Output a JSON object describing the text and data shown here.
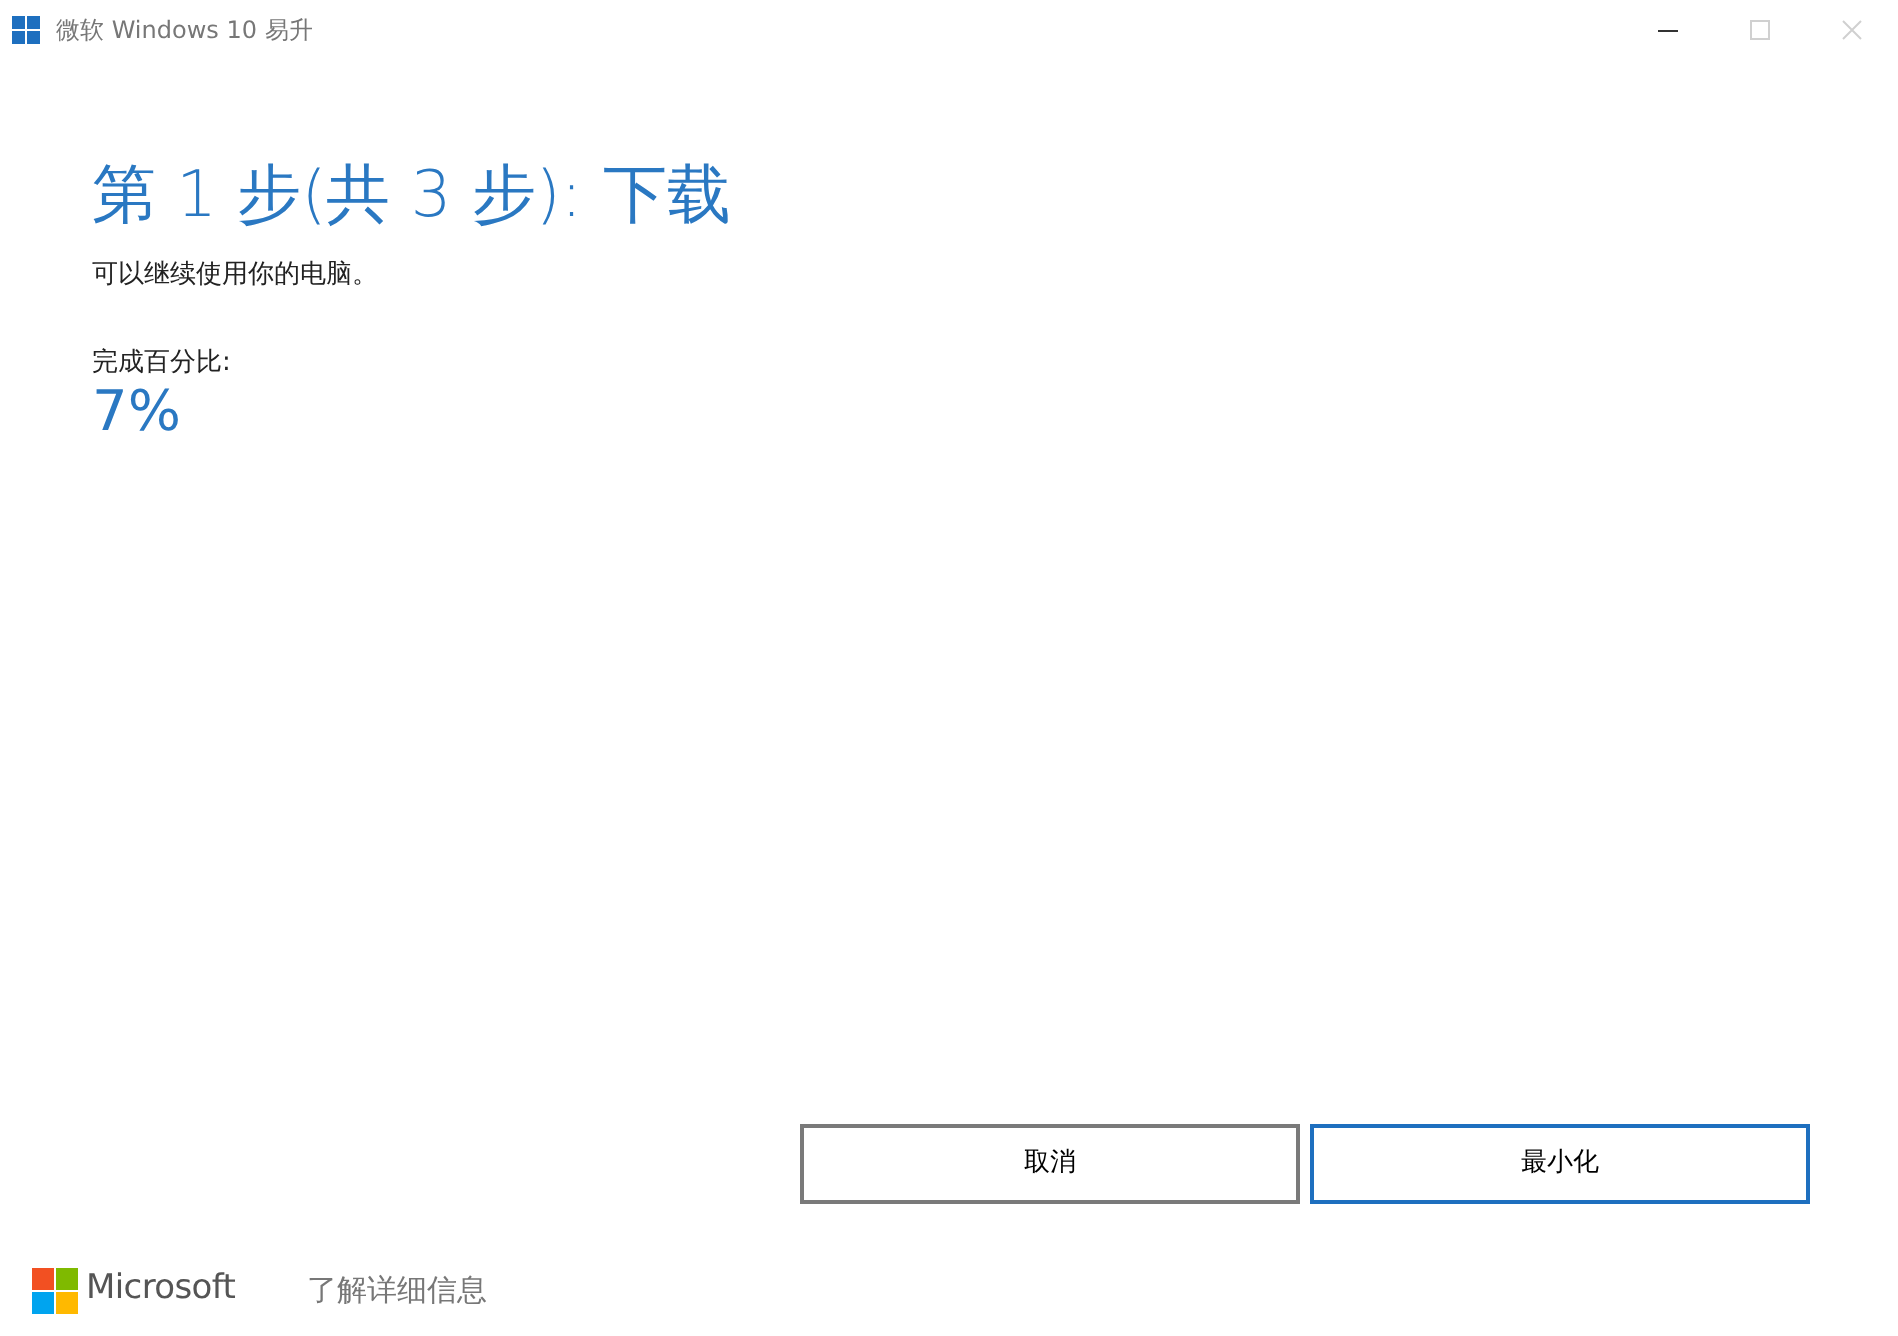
{
  "window": {
    "title": "微软 Windows 10 易升",
    "controls": [
      {
        "kind": "minimize",
        "disabled": false
      },
      {
        "kind": "maximize",
        "disabled": true
      },
      {
        "kind": "close",
        "disabled": true
      }
    ]
  },
  "heading": "第 1 步(共 3 步): 下载",
  "subtitle": "可以继续使用你的电脑。",
  "progress": {
    "label": "完成百分比:",
    "value": "7%"
  },
  "buttons": [
    {
      "label": "取消",
      "focused": false
    },
    {
      "label": "最小化",
      "focused": true
    }
  ],
  "footer": {
    "brand": "Microsoft",
    "link": "了解详细信息"
  }
}
